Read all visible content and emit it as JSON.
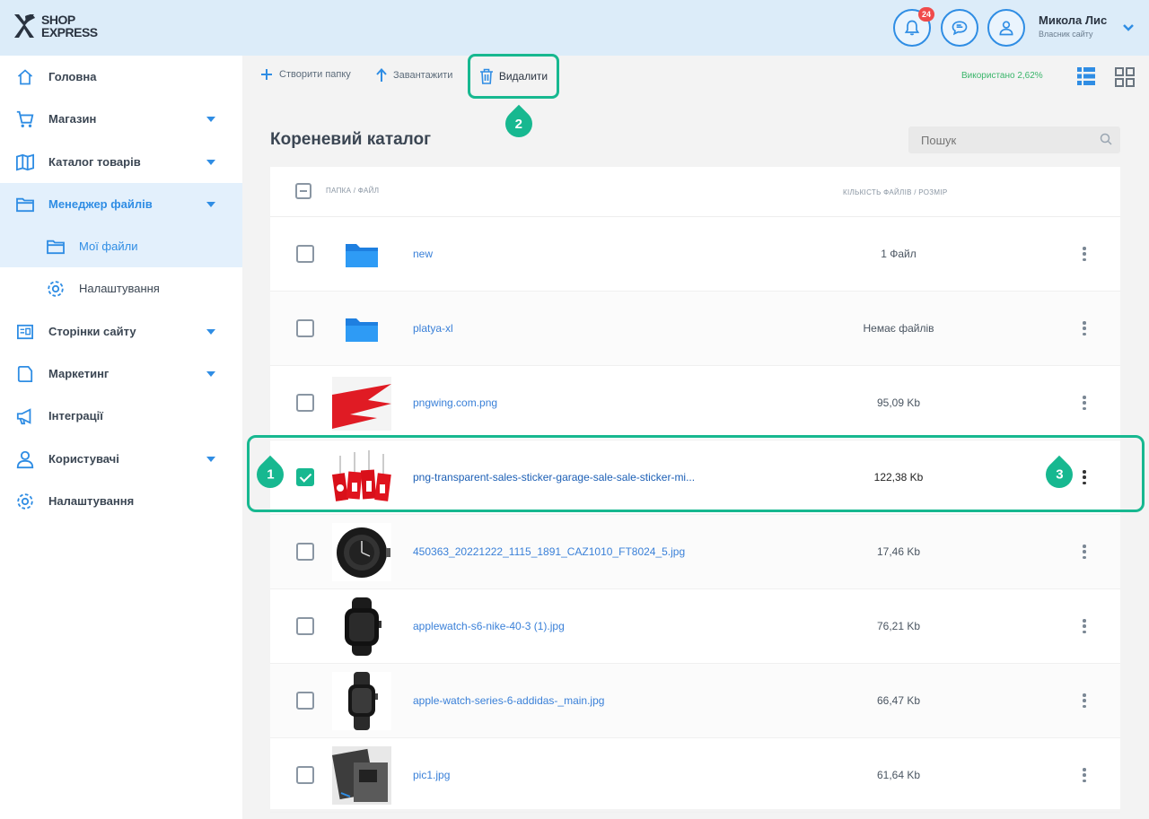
{
  "header": {
    "logo_line1": "SHOP",
    "logo_line2": "EXPRESS",
    "notifications_count": "24",
    "user_name": "Микола Лис",
    "user_subtitle": "Власник сайту"
  },
  "sidebar": {
    "items": [
      {
        "label": "Головна",
        "icon": "home-icon"
      },
      {
        "label": "Магазин",
        "icon": "cart-icon"
      },
      {
        "label": "Каталог товарів",
        "icon": "catalog-icon"
      },
      {
        "label": "Менеджер файлів",
        "icon": "folder-icon"
      },
      {
        "label": "Мої файли",
        "icon": "folder-icon"
      },
      {
        "label": "Налаштування",
        "icon": "gear-icon"
      },
      {
        "label": "Сторінки сайту",
        "icon": "pages-icon"
      },
      {
        "label": "Маркетинг",
        "icon": "marketing-icon"
      },
      {
        "label": "Інтеграції",
        "icon": "megaphone-icon"
      },
      {
        "label": "Користувачі",
        "icon": "user-icon"
      },
      {
        "label": "Налаштування",
        "icon": "gear-icon"
      }
    ]
  },
  "toolbar": {
    "create_folder": "Створити папку",
    "upload": "Завантажити",
    "delete": "Видалити",
    "used": "Використано 2,62%"
  },
  "content": {
    "title": "Кореневий каталог",
    "search_placeholder": "Пошук",
    "col_name": "Папка / Файл",
    "col_size": "Кількість файлів / Розмір"
  },
  "files": [
    {
      "name": "new",
      "size": "1 Файл",
      "type": "folder",
      "checked": false
    },
    {
      "name": "platya-xl",
      "size": "Немає файлів",
      "type": "folder",
      "checked": false
    },
    {
      "name": "pngwing.com.png",
      "size": "95,09 Kb",
      "type": "image",
      "checked": false
    },
    {
      "name": "png-transparent-sales-sticker-garage-sale-sale-sticker-mi...",
      "size": "122,38 Kb",
      "type": "image",
      "checked": true
    },
    {
      "name": "450363_20221222_1115_1891_CAZ1010_FT8024_5.jpg",
      "size": "17,46 Kb",
      "type": "image",
      "checked": false
    },
    {
      "name": "applewatch-s6-nike-40-3 (1).jpg",
      "size": "76,21 Kb",
      "type": "image",
      "checked": false
    },
    {
      "name": "apple-watch-series-6-addidas-_main.jpg",
      "size": "66,47 Kb",
      "type": "image",
      "checked": false
    },
    {
      "name": "pic1.jpg",
      "size": "61,64 Kb",
      "type": "image",
      "checked": false
    }
  ],
  "markers": [
    "1",
    "2",
    "3"
  ],
  "colors": {
    "accent": "#2f8de4",
    "highlight": "#17b890",
    "header_bg": "#dcecf9"
  }
}
